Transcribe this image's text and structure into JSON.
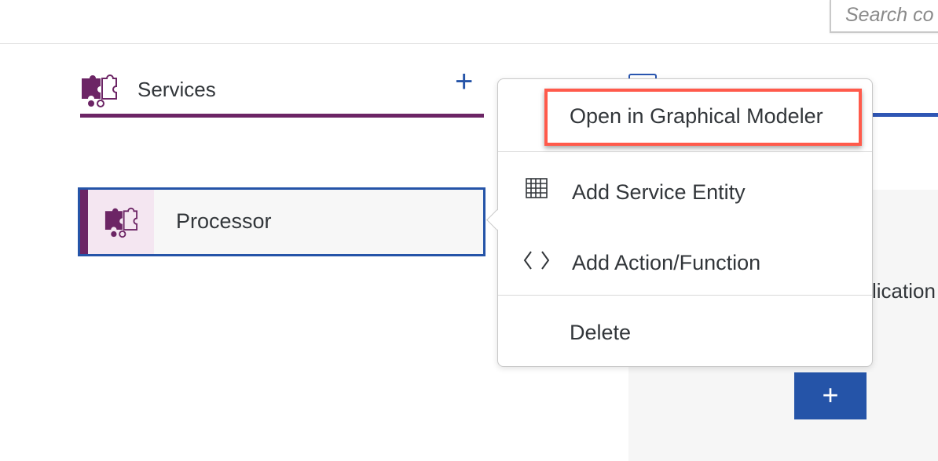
{
  "search": {
    "placeholder": "Search co"
  },
  "services_panel": {
    "title": "Services",
    "add_label": "+"
  },
  "service_item": {
    "label": "Processor"
  },
  "context_menu": {
    "items": [
      {
        "label": "Open in Graphical Modeler",
        "icon": ""
      },
      {
        "label": "Add Service Entity",
        "icon": "table-grid-icon"
      },
      {
        "label": "Add Action/Function",
        "icon": "code-brackets-icon"
      },
      {
        "label": "Delete",
        "icon": ""
      }
    ]
  },
  "right_panel": {
    "text_fragment": "lication",
    "add_label": "+"
  },
  "colors": {
    "accent_purple": "#6c2565",
    "accent_blue": "#2554a8",
    "highlight_red": "#ff5a4b"
  }
}
